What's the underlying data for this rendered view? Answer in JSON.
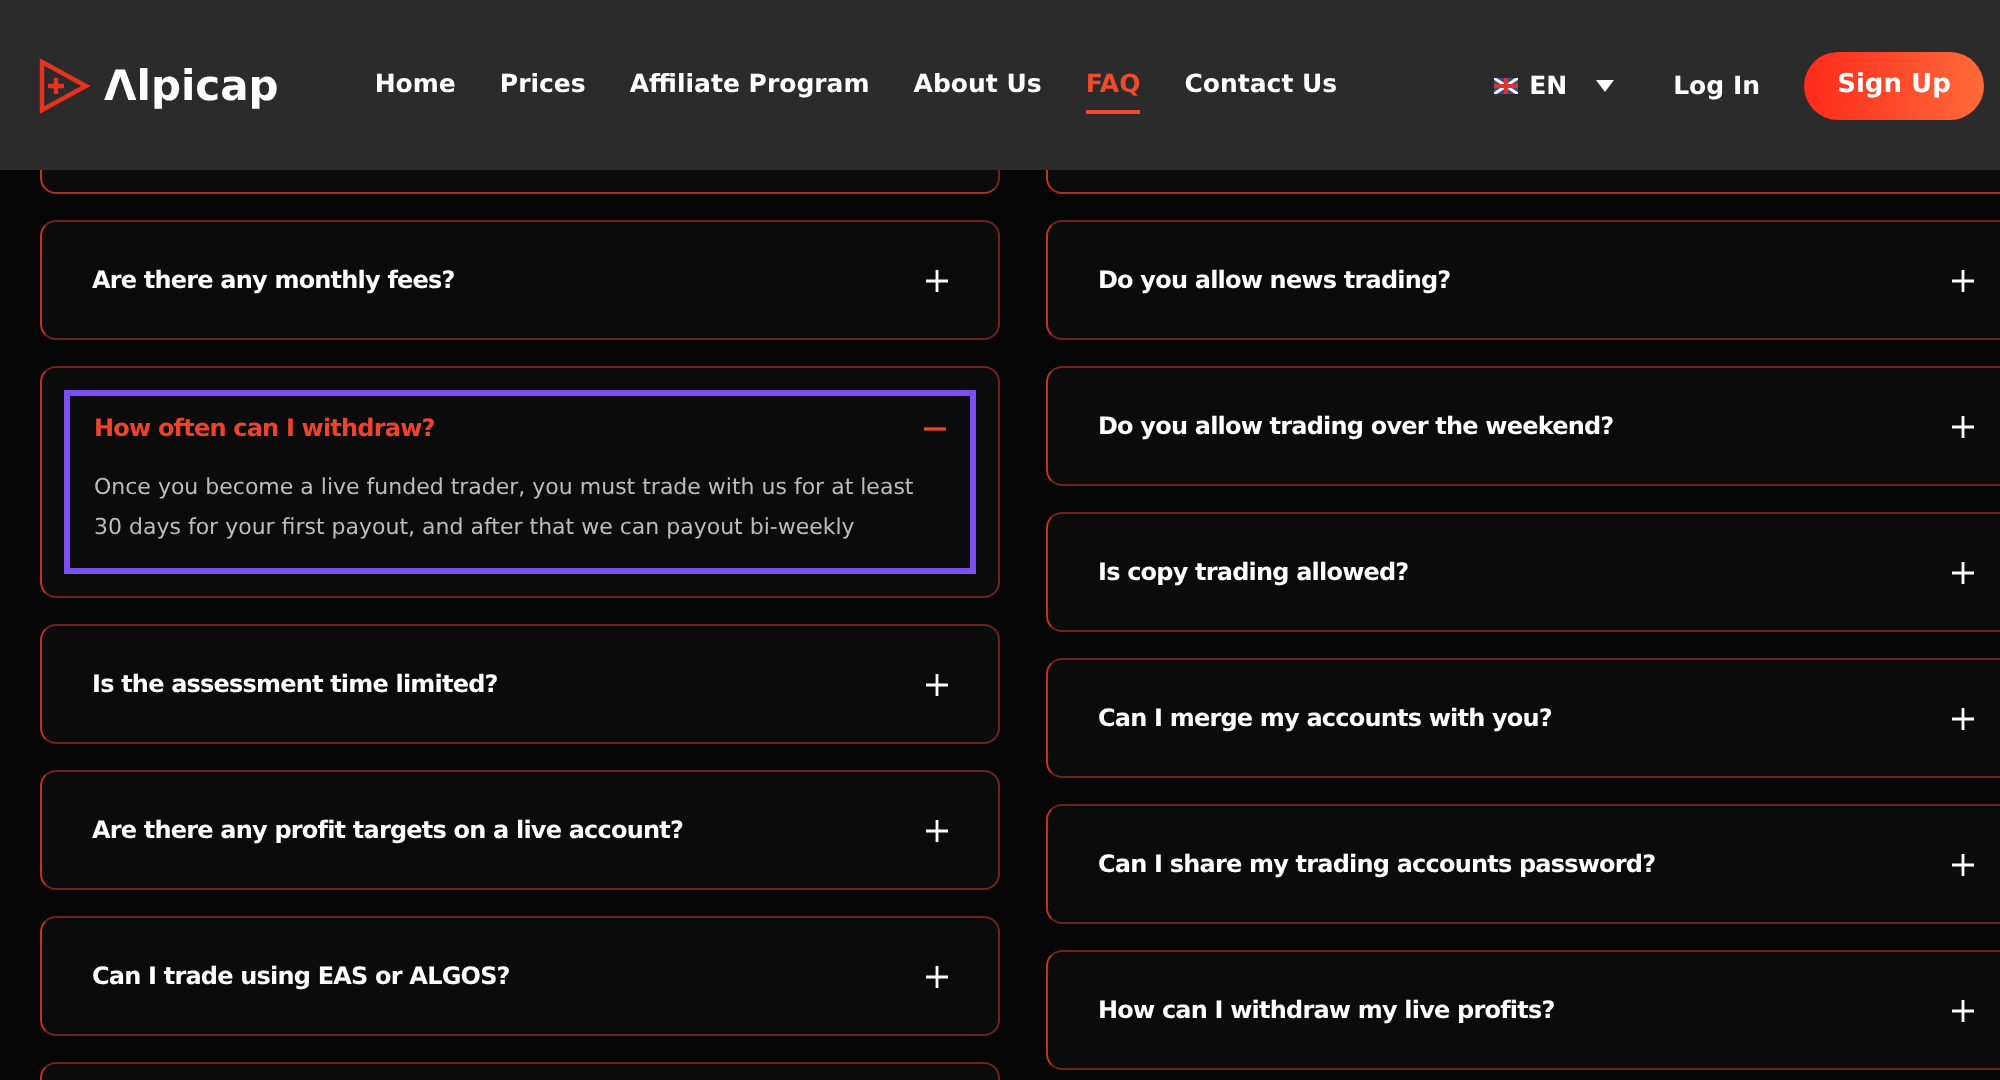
{
  "header": {
    "logo": "Λlpicap",
    "nav": [
      {
        "label": "Home",
        "selected": false
      },
      {
        "label": "Prices",
        "selected": false
      },
      {
        "label": "Affiliate Program",
        "selected": false
      },
      {
        "label": "About Us",
        "selected": false
      },
      {
        "label": "FAQ",
        "selected": true
      },
      {
        "label": "Contact Us",
        "selected": false
      }
    ],
    "language": "EN",
    "login": "Log In",
    "signup": "Sign Up"
  },
  "faq_left": [
    {
      "question": "Are there any monthly fees?",
      "expanded": false,
      "highlighted": false
    },
    {
      "question": "How often can I withdraw?",
      "expanded": true,
      "highlighted": true,
      "answer": "Once you become a live funded trader, you must trade with us for at least 30 days for your first payout, and after that we can payout bi-weekly"
    },
    {
      "question": "Is the assessment time limited?",
      "expanded": false,
      "highlighted": false
    },
    {
      "question": "Are there any profit targets on a live account?",
      "expanded": false,
      "highlighted": false
    },
    {
      "question": "Can I trade using EAS or ALGOS?",
      "expanded": false,
      "highlighted": false
    }
  ],
  "faq_right": [
    {
      "question": "Do you allow news trading?",
      "expanded": false,
      "highlighted": false
    },
    {
      "question": "Do you allow trading over the weekend?",
      "expanded": false,
      "highlighted": false
    },
    {
      "question": "Is copy trading allowed?",
      "expanded": false,
      "highlighted": false
    },
    {
      "question": "Can I merge my accounts with you?",
      "expanded": false,
      "highlighted": false
    },
    {
      "question": "Can I share my trading accounts password?",
      "expanded": false,
      "highlighted": false
    },
    {
      "question": "How can I withdraw my live profits?",
      "expanded": false,
      "highlighted": false
    }
  ]
}
